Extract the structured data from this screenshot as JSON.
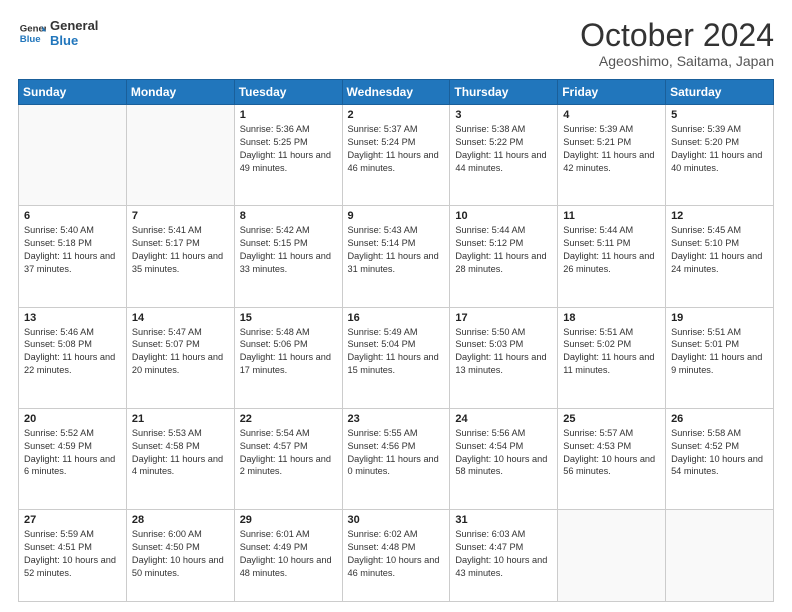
{
  "header": {
    "logo_line1": "General",
    "logo_line2": "Blue",
    "month": "October 2024",
    "location": "Ageoshimo, Saitama, Japan"
  },
  "weekdays": [
    "Sunday",
    "Monday",
    "Tuesday",
    "Wednesday",
    "Thursday",
    "Friday",
    "Saturday"
  ],
  "weeks": [
    [
      {
        "day": "",
        "info": ""
      },
      {
        "day": "",
        "info": ""
      },
      {
        "day": "1",
        "info": "Sunrise: 5:36 AM\nSunset: 5:25 PM\nDaylight: 11 hours and 49 minutes."
      },
      {
        "day": "2",
        "info": "Sunrise: 5:37 AM\nSunset: 5:24 PM\nDaylight: 11 hours and 46 minutes."
      },
      {
        "day": "3",
        "info": "Sunrise: 5:38 AM\nSunset: 5:22 PM\nDaylight: 11 hours and 44 minutes."
      },
      {
        "day": "4",
        "info": "Sunrise: 5:39 AM\nSunset: 5:21 PM\nDaylight: 11 hours and 42 minutes."
      },
      {
        "day": "5",
        "info": "Sunrise: 5:39 AM\nSunset: 5:20 PM\nDaylight: 11 hours and 40 minutes."
      }
    ],
    [
      {
        "day": "6",
        "info": "Sunrise: 5:40 AM\nSunset: 5:18 PM\nDaylight: 11 hours and 37 minutes."
      },
      {
        "day": "7",
        "info": "Sunrise: 5:41 AM\nSunset: 5:17 PM\nDaylight: 11 hours and 35 minutes."
      },
      {
        "day": "8",
        "info": "Sunrise: 5:42 AM\nSunset: 5:15 PM\nDaylight: 11 hours and 33 minutes."
      },
      {
        "day": "9",
        "info": "Sunrise: 5:43 AM\nSunset: 5:14 PM\nDaylight: 11 hours and 31 minutes."
      },
      {
        "day": "10",
        "info": "Sunrise: 5:44 AM\nSunset: 5:12 PM\nDaylight: 11 hours and 28 minutes."
      },
      {
        "day": "11",
        "info": "Sunrise: 5:44 AM\nSunset: 5:11 PM\nDaylight: 11 hours and 26 minutes."
      },
      {
        "day": "12",
        "info": "Sunrise: 5:45 AM\nSunset: 5:10 PM\nDaylight: 11 hours and 24 minutes."
      }
    ],
    [
      {
        "day": "13",
        "info": "Sunrise: 5:46 AM\nSunset: 5:08 PM\nDaylight: 11 hours and 22 minutes."
      },
      {
        "day": "14",
        "info": "Sunrise: 5:47 AM\nSunset: 5:07 PM\nDaylight: 11 hours and 20 minutes."
      },
      {
        "day": "15",
        "info": "Sunrise: 5:48 AM\nSunset: 5:06 PM\nDaylight: 11 hours and 17 minutes."
      },
      {
        "day": "16",
        "info": "Sunrise: 5:49 AM\nSunset: 5:04 PM\nDaylight: 11 hours and 15 minutes."
      },
      {
        "day": "17",
        "info": "Sunrise: 5:50 AM\nSunset: 5:03 PM\nDaylight: 11 hours and 13 minutes."
      },
      {
        "day": "18",
        "info": "Sunrise: 5:51 AM\nSunset: 5:02 PM\nDaylight: 11 hours and 11 minutes."
      },
      {
        "day": "19",
        "info": "Sunrise: 5:51 AM\nSunset: 5:01 PM\nDaylight: 11 hours and 9 minutes."
      }
    ],
    [
      {
        "day": "20",
        "info": "Sunrise: 5:52 AM\nSunset: 4:59 PM\nDaylight: 11 hours and 6 minutes."
      },
      {
        "day": "21",
        "info": "Sunrise: 5:53 AM\nSunset: 4:58 PM\nDaylight: 11 hours and 4 minutes."
      },
      {
        "day": "22",
        "info": "Sunrise: 5:54 AM\nSunset: 4:57 PM\nDaylight: 11 hours and 2 minutes."
      },
      {
        "day": "23",
        "info": "Sunrise: 5:55 AM\nSunset: 4:56 PM\nDaylight: 11 hours and 0 minutes."
      },
      {
        "day": "24",
        "info": "Sunrise: 5:56 AM\nSunset: 4:54 PM\nDaylight: 10 hours and 58 minutes."
      },
      {
        "day": "25",
        "info": "Sunrise: 5:57 AM\nSunset: 4:53 PM\nDaylight: 10 hours and 56 minutes."
      },
      {
        "day": "26",
        "info": "Sunrise: 5:58 AM\nSunset: 4:52 PM\nDaylight: 10 hours and 54 minutes."
      }
    ],
    [
      {
        "day": "27",
        "info": "Sunrise: 5:59 AM\nSunset: 4:51 PM\nDaylight: 10 hours and 52 minutes."
      },
      {
        "day": "28",
        "info": "Sunrise: 6:00 AM\nSunset: 4:50 PM\nDaylight: 10 hours and 50 minutes."
      },
      {
        "day": "29",
        "info": "Sunrise: 6:01 AM\nSunset: 4:49 PM\nDaylight: 10 hours and 48 minutes."
      },
      {
        "day": "30",
        "info": "Sunrise: 6:02 AM\nSunset: 4:48 PM\nDaylight: 10 hours and 46 minutes."
      },
      {
        "day": "31",
        "info": "Sunrise: 6:03 AM\nSunset: 4:47 PM\nDaylight: 10 hours and 43 minutes."
      },
      {
        "day": "",
        "info": ""
      },
      {
        "day": "",
        "info": ""
      }
    ]
  ]
}
